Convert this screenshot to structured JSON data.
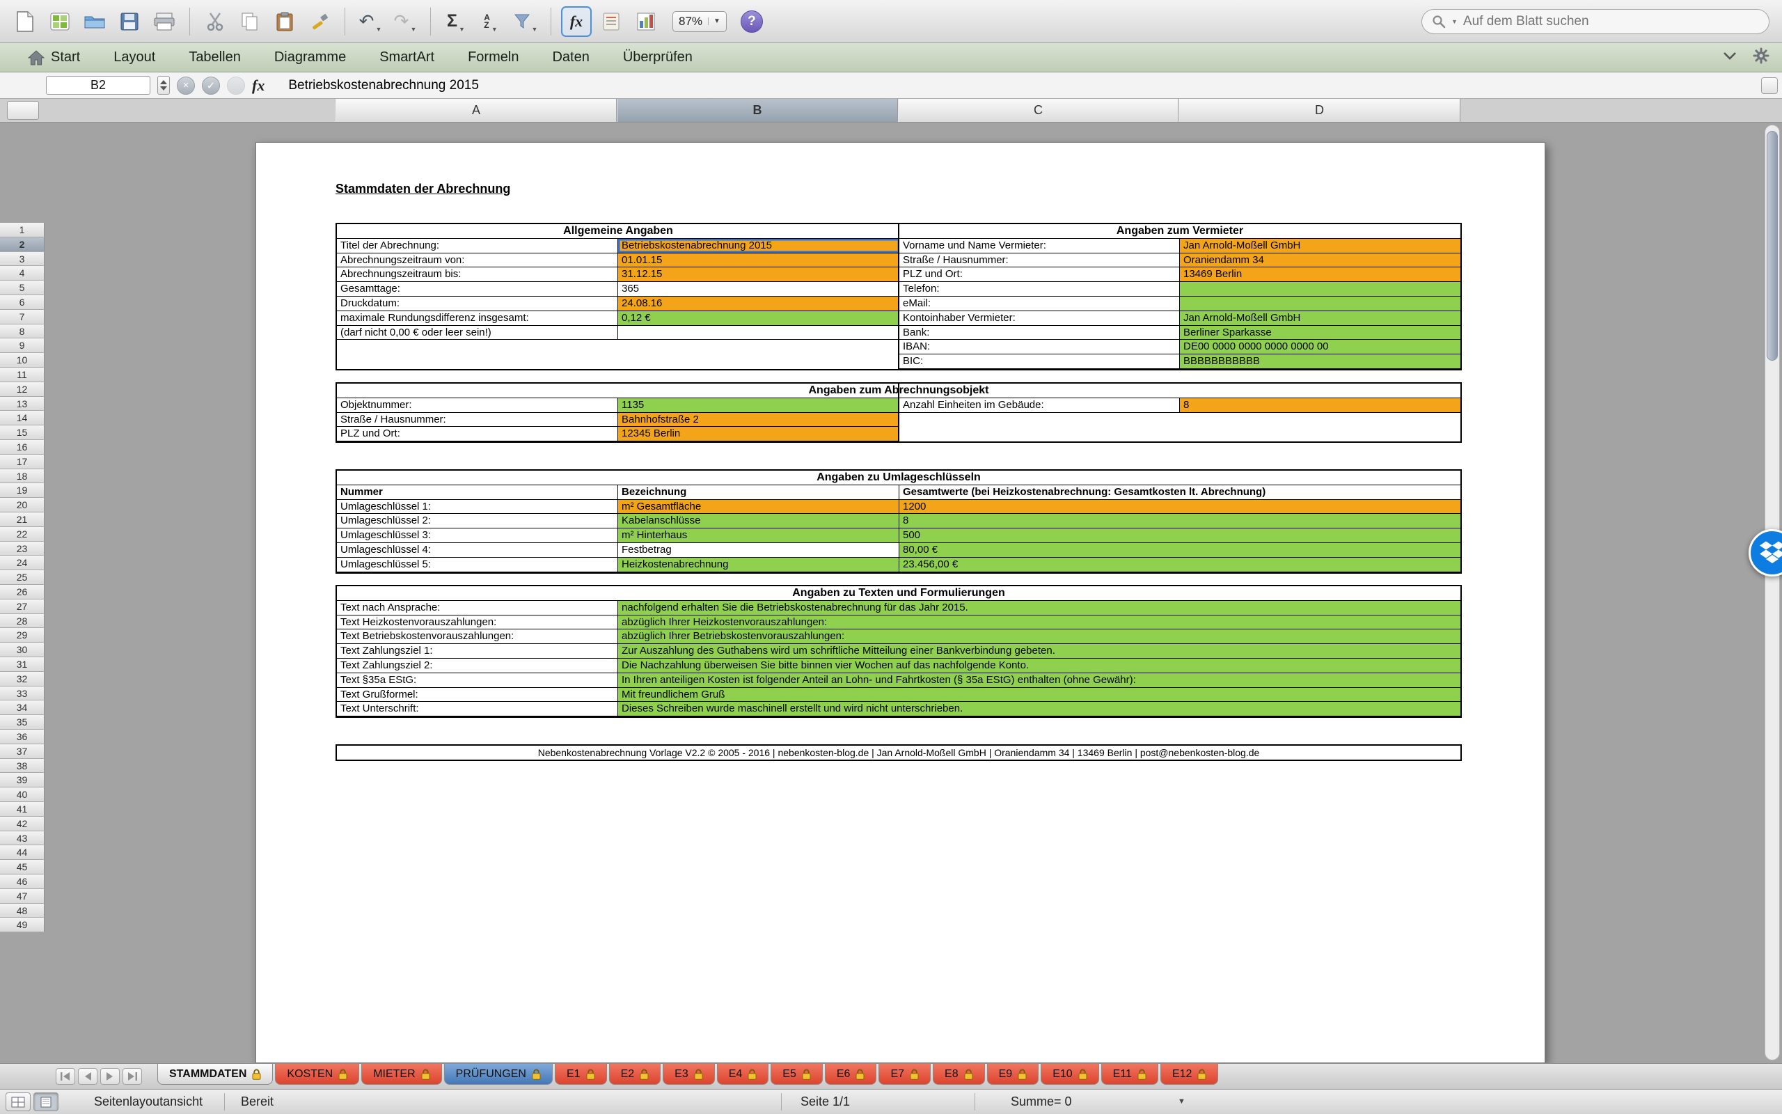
{
  "palette": {
    "fill_orange": "#F4A418",
    "fill_green": "#8FD04E",
    "fill_white": "#FFFFFF",
    "selection_blue": "#2E6FD8",
    "tab_red": "#E54F39",
    "tab_blue": "#4E86C6",
    "tab_active_gray": "#EFEFEF",
    "lock_gold": "#F2C233",
    "dropbox_blue": "#0D7DE1",
    "help_purple": "#7E6BC9"
  },
  "toolbar": {
    "zoom_value": "87%",
    "search_placeholder": "Auf dem Blatt suchen",
    "help_glyph": "?",
    "glyphs": {
      "undo": "↶",
      "redo": "↷",
      "autosum": "Σ",
      "sort_a": "A",
      "sort_z": "Z",
      "dropdown": "▼"
    },
    "icon_names": [
      "new-workbook",
      "workbook-gallery",
      "open",
      "save",
      "print",
      "cut",
      "copy",
      "paste",
      "format-painter",
      "undo",
      "redo",
      "autosum",
      "sort",
      "filter",
      "formula-builder",
      "toolbox",
      "charts",
      "zoom",
      "help",
      "search"
    ]
  },
  "ribbon": {
    "tabs": [
      "Start",
      "Layout",
      "Tabellen",
      "Diagramme",
      "SmartArt",
      "Formeln",
      "Daten",
      "Überprüfen"
    ]
  },
  "formula_bar": {
    "cell_ref": "B2",
    "cancel_glyph": "×",
    "accept_glyph": "✓",
    "fx_label": "fx",
    "formula": "Betriebskostenabrechnung 2015"
  },
  "grid": {
    "columns": [
      "A",
      "B",
      "C",
      "D"
    ],
    "selected_column": "B",
    "row_start": 1,
    "row_end": 49,
    "selected_row": 2
  },
  "page": {
    "title": "Stammdaten der Abrechnung",
    "table_allgemein": {
      "header_left": "Allgemeine Angaben",
      "header_right": "Angaben zum Vermieter",
      "rows_left": [
        {
          "label": "Titel der Abrechnung:",
          "value": "Betriebskostenabrechnung 2015",
          "fill": "orange",
          "selected": true
        },
        {
          "label": "Abrechnungszeitraum von:",
          "value": "01.01.15",
          "fill": "orange"
        },
        {
          "label": "Abrechnungszeitraum bis:",
          "value": "31.12.15",
          "fill": "orange"
        },
        {
          "label": "Gesamttage:",
          "value": "365",
          "fill": "white"
        },
        {
          "label": "Druckdatum:",
          "value": "24.08.16",
          "fill": "orange"
        },
        {
          "label": "maximale Rundungsdifferenz insgesamt:",
          "value": "0,12 €",
          "fill": "green"
        },
        {
          "label": "(darf nicht 0,00 € oder leer sein!)",
          "value": "",
          "fill": "white"
        }
      ],
      "rows_right": [
        {
          "label": "Vorname und Name Vermieter:",
          "value": "Jan Arnold-Moßell GmbH",
          "fill": "orange"
        },
        {
          "label": "Straße / Hausnummer:",
          "value": "Oraniendamm 34",
          "fill": "orange"
        },
        {
          "label": "PLZ und Ort:",
          "value": "13469 Berlin",
          "fill": "orange"
        },
        {
          "label": "Telefon:",
          "value": "",
          "fill": "green"
        },
        {
          "label": "eMail:",
          "value": "",
          "fill": "green"
        },
        {
          "label": "Kontoinhaber Vermieter:",
          "value": "Jan Arnold-Moßell GmbH",
          "fill": "green"
        },
        {
          "label": "Bank:",
          "value": "Berliner Sparkasse",
          "fill": "green"
        },
        {
          "label": "IBAN:",
          "value": "DE00 0000 0000 0000 0000 00",
          "fill": "green"
        },
        {
          "label": "BIC:",
          "value": "BBBBBBBBBBB",
          "fill": "green"
        }
      ]
    },
    "table_objekt": {
      "header": "Angaben zum Abrechnungsobjekt",
      "rows_left": [
        {
          "label": "Objektnummer:",
          "value": "1135",
          "fill": "green"
        },
        {
          "label": "Straße / Hausnummer:",
          "value": "Bahnhofstraße 2",
          "fill": "orange"
        },
        {
          "label": "PLZ und Ort:",
          "value": "12345 Berlin",
          "fill": "orange"
        }
      ],
      "rows_right": [
        {
          "label": "Anzahl Einheiten im Gebäude:",
          "value": "8",
          "fill": "orange"
        }
      ]
    },
    "table_umlage": {
      "header": "Angaben zu Umlageschlüsseln",
      "col_headers": [
        "Nummer",
        "Bezeichnung",
        "Gesamtwerte (bei Heizkostenabrechnung: Gesamtkosten lt. Abrechnung)"
      ],
      "rows": [
        {
          "nummer": "Umlageschlüssel 1:",
          "bezeichnung": "m² Gesamtfläche",
          "bezeichnung_fill": "orange",
          "wert": "1200",
          "wert_fill": "orange"
        },
        {
          "nummer": "Umlageschlüssel 2:",
          "bezeichnung": "Kabelanschlüsse",
          "bezeichnung_fill": "green",
          "wert": "8",
          "wert_fill": "green"
        },
        {
          "nummer": "Umlageschlüssel 3:",
          "bezeichnung": "m² Hinterhaus",
          "bezeichnung_fill": "green",
          "wert": "500",
          "wert_fill": "green"
        },
        {
          "nummer": "Umlageschlüssel 4:",
          "bezeichnung": "Festbetrag",
          "bezeichnung_fill": "white",
          "wert": "80,00 €",
          "wert_fill": "green"
        },
        {
          "nummer": "Umlageschlüssel 5:",
          "bezeichnung": "Heizkostenabrechnung",
          "bezeichnung_fill": "green",
          "wert": "23.456,00 €",
          "wert_fill": "green"
        }
      ]
    },
    "table_texte": {
      "header": "Angaben zu Texten und Formulierungen",
      "rows": [
        {
          "label": "Text nach Ansprache:",
          "value": "nachfolgend erhalten Sie die Betriebskostenabrechnung für das Jahr 2015.",
          "fill": "green"
        },
        {
          "label": "Text Heizkostenvorauszahlungen:",
          "value": "abzüglich Ihrer Heizkostenvorauszahlungen:",
          "fill": "green"
        },
        {
          "label": "Text Betriebskostenvorauszahlungen:",
          "value": "abzüglich Ihrer Betriebskostenvorauszahlungen:",
          "fill": "green"
        },
        {
          "label": "Text Zahlungsziel 1:",
          "value": "Zur Auszahlung des Guthabens wird um schriftliche Mitteilung einer Bankverbindung gebeten.",
          "fill": "green"
        },
        {
          "label": "Text Zahlungsziel 2:",
          "value": "Die Nachzahlung überweisen Sie bitte binnen vier Wochen auf das nachfolgende Konto.",
          "fill": "green"
        },
        {
          "label": "Text §35a EStG:",
          "value": "In Ihren anteiligen Kosten ist folgender Anteil an Lohn- und Fahrtkosten (§ 35a EStG) enthalten (ohne Gewähr):",
          "fill": "green"
        },
        {
          "label": "Text Grußformel:",
          "value": "Mit freundlichem Gruß",
          "fill": "green"
        },
        {
          "label": "Text Unterschrift:",
          "value": "Dieses Schreiben wurde maschinell erstellt und wird nicht unterschrieben.",
          "fill": "green"
        }
      ]
    },
    "footer": "Nebenkostenabrechnung Vorlage V2.2 © 2005 - 2016 | nebenkosten-blog.de | Jan Arnold-Moßell GmbH | Oraniendamm 34 | 13469 Berlin | post@nebenkosten-blog.de"
  },
  "sheet_tabs": {
    "tabs": [
      {
        "label": "STAMMDATEN",
        "style": "active",
        "locked": true
      },
      {
        "label": "KOSTEN",
        "style": "red",
        "locked": true
      },
      {
        "label": "MIETER",
        "style": "red",
        "locked": true
      },
      {
        "label": "PRÜFUNGEN",
        "style": "blue",
        "locked": true
      },
      {
        "label": "E1",
        "style": "red",
        "locked": true
      },
      {
        "label": "E2",
        "style": "red",
        "locked": true
      },
      {
        "label": "E3",
        "style": "red",
        "locked": true
      },
      {
        "label": "E4",
        "style": "red",
        "locked": true
      },
      {
        "label": "E5",
        "style": "red",
        "locked": true
      },
      {
        "label": "E6",
        "style": "red",
        "locked": true
      },
      {
        "label": "E7",
        "style": "red",
        "locked": true
      },
      {
        "label": "E8",
        "style": "red",
        "locked": true
      },
      {
        "label": "E9",
        "style": "red",
        "locked": true
      },
      {
        "label": "E10",
        "style": "red",
        "locked": true
      },
      {
        "label": "E11",
        "style": "red",
        "locked": true
      },
      {
        "label": "E12",
        "style": "red",
        "locked": true
      }
    ]
  },
  "status_bar": {
    "view_mode": "Seitenlayoutansicht",
    "status": "Bereit",
    "page_indicator": "Seite 1/1",
    "sum_indicator": "Summe= 0"
  }
}
